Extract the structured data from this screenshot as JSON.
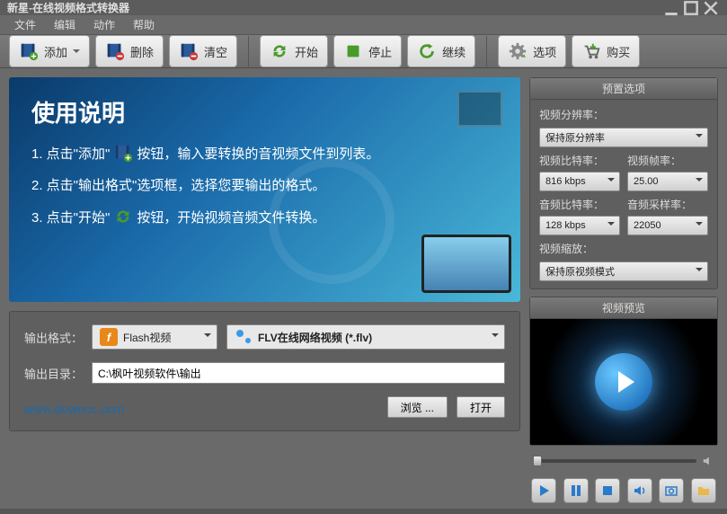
{
  "title": "新星-在线视频格式转换器",
  "menu": {
    "file": "文件",
    "edit": "编辑",
    "action": "动作",
    "help": "帮助"
  },
  "toolbar": {
    "add": "添加",
    "delete": "删除",
    "clear": "清空",
    "start": "开始",
    "stop": "停止",
    "continue": "继续",
    "options": "选项",
    "buy": "购买"
  },
  "banner": {
    "heading": "使用说明",
    "step1a": "1. 点击\"添加\"",
    "step1b": "按钮，输入要转换的音视频文件到列表。",
    "step2": "2. 点击\"输出格式\"选项框，选择您要输出的格式。",
    "step3a": "3. 点击\"开始\"",
    "step3b": "按钮，开始视频音频文件转换。"
  },
  "output": {
    "format_label": "输出格式：",
    "flash_label": "Flash视频",
    "flv_label": "FLV在线网络视频 (*.flv)",
    "dir_label": "输出目录：",
    "dir_value": "C:\\枫叶视频软件\\输出",
    "browse": "浏览 ...",
    "open": "打开",
    "url": "www.downcc.com"
  },
  "preset": {
    "title": "预置选项",
    "resolution_label": "视频分辨率：",
    "resolution_value": "保持原分辨率",
    "vbitrate_label": "视频比特率：",
    "vbitrate_value": "816 kbps",
    "vfps_label": "视频帧率：",
    "vfps_value": "25.00",
    "abitrate_label": "音频比特率：",
    "abitrate_value": "128 kbps",
    "asample_label": "音频采样率：",
    "asample_value": "22050",
    "zoom_label": "视频缩放：",
    "zoom_value": "保持原视频模式"
  },
  "preview": {
    "title": "视频预览"
  }
}
